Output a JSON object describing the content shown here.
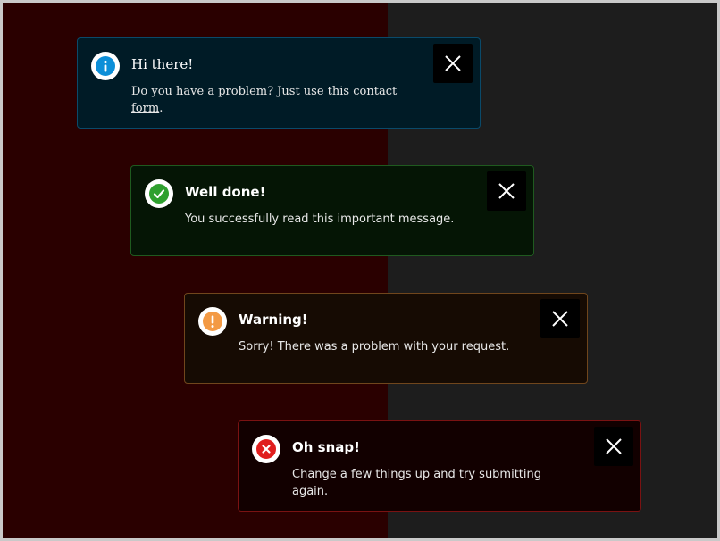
{
  "alerts": {
    "info": {
      "title": "Hi there!",
      "message_before": "Do you have a problem? Just use this ",
      "link_text": "contact form",
      "message_after": ".",
      "icon": "info-icon",
      "accent": "#0d8fd8"
    },
    "success": {
      "title": "Well done!",
      "message": "You successfully read this important message.",
      "icon": "check-icon",
      "accent": "#2fa02f"
    },
    "warning": {
      "title": "Warning!",
      "message": "Sorry! There was a problem with your request.",
      "icon": "exclamation-icon",
      "accent": "#f39a45"
    },
    "error": {
      "title": "Oh snap!",
      "message": "Change a few things up and try submitting again.",
      "icon": "x-icon",
      "accent": "#e01e1e"
    }
  },
  "close_icon": "close-icon",
  "colors": {
    "left_background": "#2a0000",
    "right_background": "#1d1d1d"
  }
}
